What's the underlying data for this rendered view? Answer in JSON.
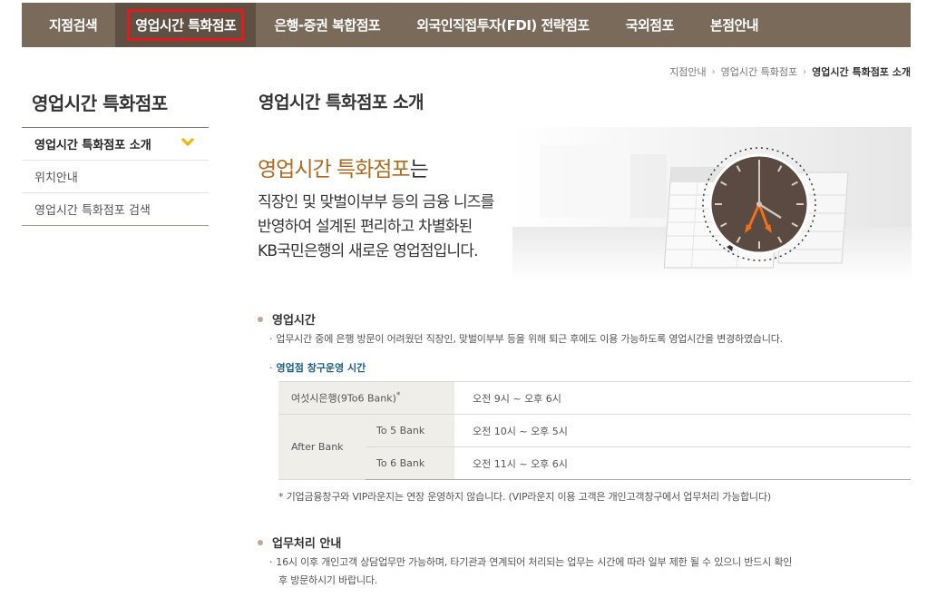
{
  "topnav": {
    "items": [
      {
        "label": "지점검색"
      },
      {
        "label": "영업시간 특화점포"
      },
      {
        "label": "은행-증권 복합점포"
      },
      {
        "label": "외국인직접투자(FDI) 전략점포"
      },
      {
        "label": "국외점포"
      },
      {
        "label": "본점안내"
      }
    ]
  },
  "breadcrumb": {
    "items": [
      "지점안내",
      "영업시간 특화점포",
      "영업시간 특화점포 소개"
    ]
  },
  "sidebar": {
    "title": "영업시간 특화점포",
    "items": [
      {
        "label": "영업시간 특화점포 소개"
      },
      {
        "label": "위치안내"
      },
      {
        "label": "영업시간 특화점포 검색"
      }
    ]
  },
  "main": {
    "title": "영업시간 특화점포 소개",
    "hero": {
      "highlight": "영업시간 특화점포",
      "suffix": "는",
      "lines": [
        "직장인 및  맞벌이부부 등의 금융 니즈를",
        "반영하여 설계된 편리하고 차별화된",
        "KB국민은행의 새로운 영업점입니다."
      ]
    },
    "section1": {
      "title": "영업시간",
      "desc": "업무시간 중에 은행 방문이 어려웠던 직장인, 맞벌이부부 등을 위해 퇴근 후에도 이용 가능하도록 영업시간을 변경하였습니다.",
      "subtitle": "영업점 창구운영 시간",
      "table": {
        "row1_label": "여섯시은행(9To6 Bank)",
        "row1_sup": "*",
        "row1_value": "오전 9시 ~ 오후 6시",
        "after_label": "After Bank",
        "to5_label": "To 5 Bank",
        "to5_value": "오전 10시 ~ 오후 5시",
        "to6_label": "To 6 Bank",
        "to6_value": "오전 11시 ~ 오후 6시"
      },
      "note": "* 기업금융창구와 VIP라운지는 연장 운영하지 않습니다. (VIP라운지 이용 고객은 개인고객창구에서 업무처리 가능합니다)"
    },
    "section2": {
      "title": "업무처리 안내",
      "desc_line1": "16시 이후 개인고객 상담업무만 가능하며, 타기관과 연계되어 처리되는 업무는 시간에 따라 일부 제한 될 수 있으니 반드시 확인",
      "desc_line2": "후 방문하시기 바랍니다."
    }
  },
  "colors": {
    "nav_bg": "#7a6a5a",
    "nav_active_bg": "#5f5043",
    "highlight_box": "#e11c1c",
    "hero_highlight": "#b06a1e",
    "chevron": "#f0b400",
    "subtitle_blue": "#1a5e8c",
    "clock_face": "#5a4a42",
    "clock_hand": "#f07020"
  },
  "icons": {
    "chevron": "chevron-down-icon",
    "bullet": "dot-bullet-icon",
    "clock": "clock-illustration"
  }
}
